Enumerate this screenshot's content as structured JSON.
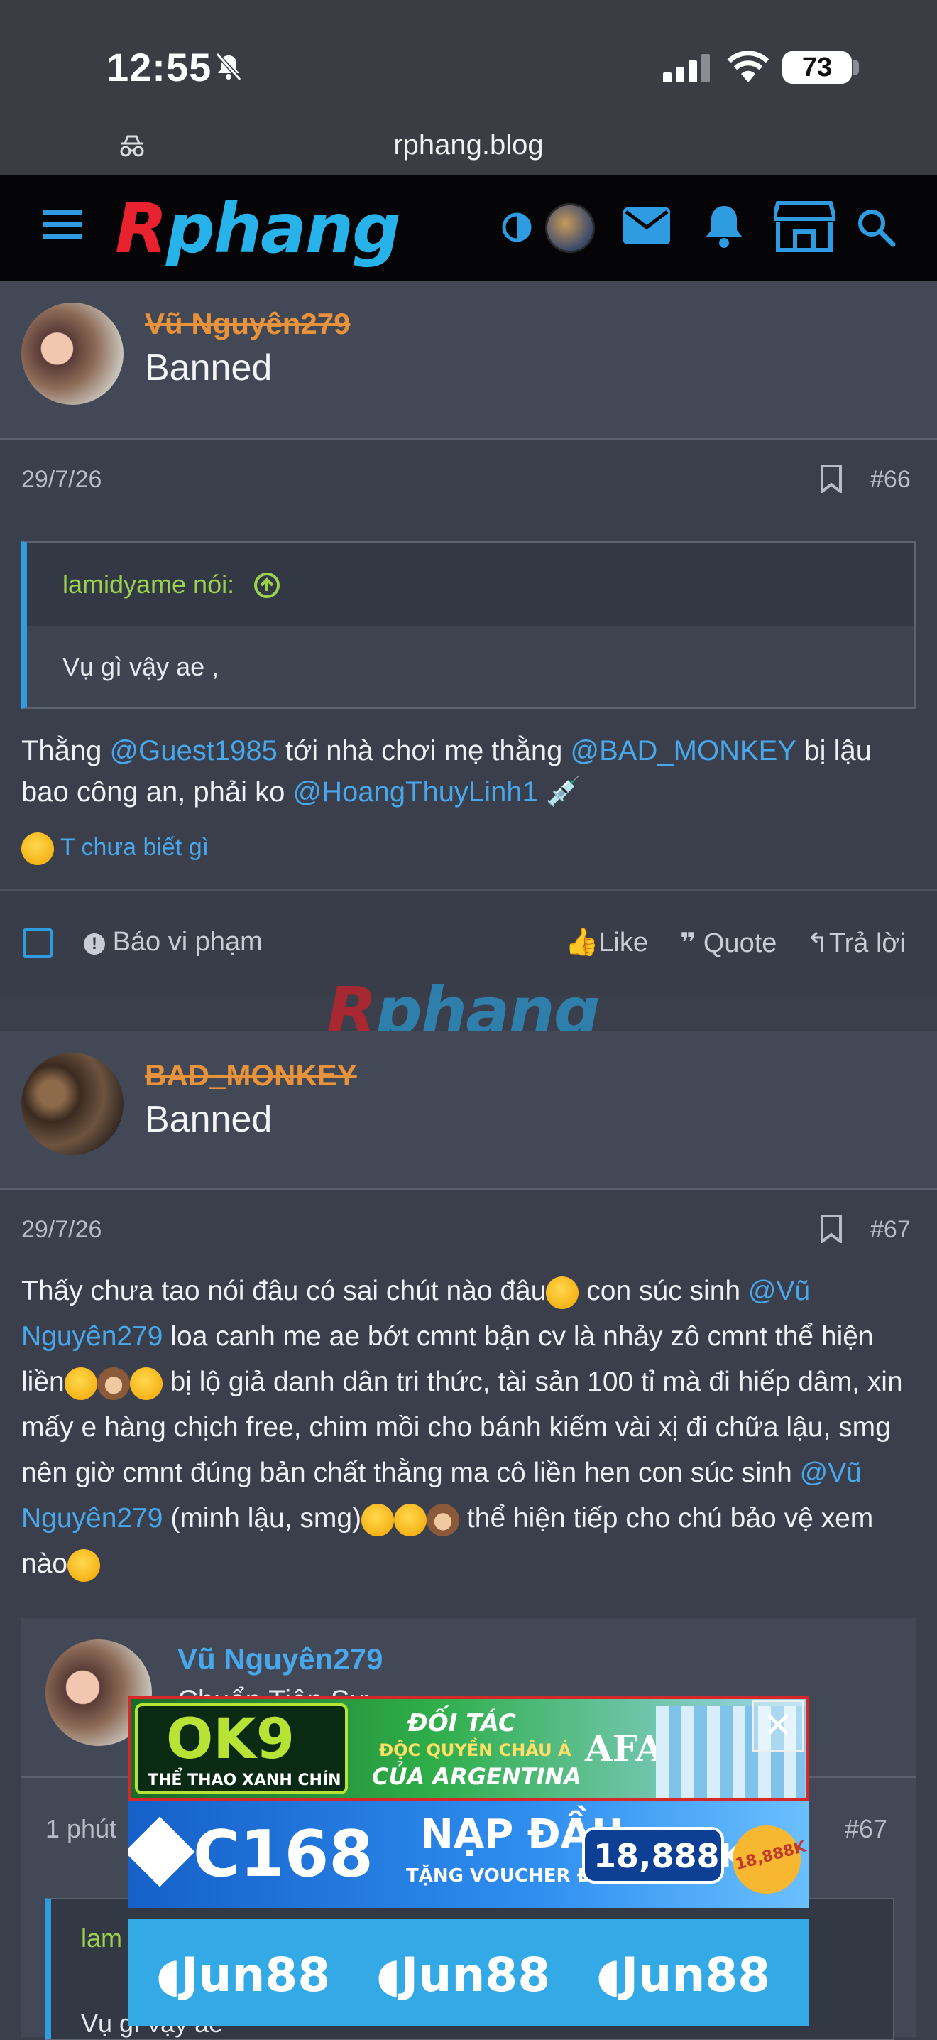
{
  "status_bar": {
    "time": "12:55",
    "battery": "73"
  },
  "browser": {
    "url": "rphang.blog"
  },
  "site": {
    "logo_r": "R",
    "logo_rest": "phang"
  },
  "posts": [
    {
      "username": "Vũ Nguyên279",
      "title": "Banned",
      "date": "29/7/26",
      "number": "#66",
      "quote_author": "lamidyame nói:",
      "quote_text": "Vụ gì vậy ae ,",
      "body": {
        "t1": "Thằng ",
        "m1": "@Guest1985",
        "t2": " tới nhà chơi mẹ thằng ",
        "m2": "@BAD_MONKEY",
        "t3": " bị lậu bao công an, phải ko ",
        "m3": "@HoangThuyLinh1",
        "t4": " 💉"
      },
      "reaction": "T chưa biết gì",
      "actions": {
        "report": "Báo vi phạm",
        "like": "Like",
        "quote": "Quote",
        "reply": "Trả lời"
      }
    },
    {
      "username": "BAD_MONKEY",
      "title": "Banned",
      "date": "29/7/26",
      "number": "#67",
      "body": {
        "t1": "Thấy chưa tao nói đâu có sai chút nào đâu",
        "t2": " con súc sinh ",
        "m1": "@Vũ Nguyên279",
        "t3": " loa canh me ae bớt cmnt bận cv là nhảy zô cmnt thể hiện liền",
        "t4": " bị lộ giả danh dân tri thức, tài sản 100 tỉ mà đi hiếp dâm, xin mấy e hàng chịch free, chim mồi cho bánh kiếm vài xị đi chữa lậu, smg nên giờ cmnt đúng bản chất thằng ma cô liền hen con súc sinh ",
        "m2": "@Vũ Nguyên279",
        "t5": " (minh lậu, smg)",
        "t6": " thể hiện tiếp cho chú bảo vệ xem nào"
      },
      "nested": {
        "username": "Vũ Nguyên279",
        "subtitle": "Chuẩn Tiên Sư",
        "time": "1 phút",
        "number": "#67",
        "quote_author": "lam",
        "quote_text": "Vụ gì vậy ae"
      }
    }
  ],
  "watermark": {
    "r": "R",
    "rest": "phang"
  },
  "ads": {
    "ok9": {
      "brand": "OK9",
      "tagline": "THỂ THAO XANH CHÍN",
      "headline": "ĐỐI TÁC",
      "sub1": "ĐỘC QUYỀN CHÂU Á",
      "sub2": "CỦA ARGENTINA",
      "badge": "AFA"
    },
    "c168": {
      "brand": "C168",
      "headline": "NẠP ĐẦU",
      "sub": "TẶNG VOUCHER ĐẾN",
      "amount": "18,888K",
      "small": "18,888K"
    },
    "jun88": {
      "brand": "Jun88"
    },
    "close": "✕"
  },
  "colors": {
    "accent": "#49a8ec",
    "banned_name": "#e9923c",
    "quote_author": "#9bd14e",
    "nav_bg": "#050507"
  }
}
